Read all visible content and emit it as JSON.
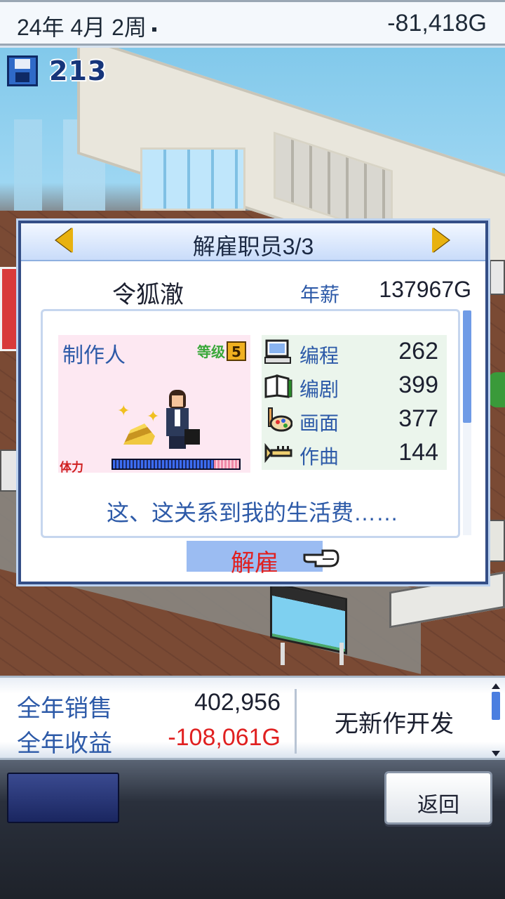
{
  "status_bar": {
    "date": "24年 4月 2周",
    "money": "-81,418G"
  },
  "save": {
    "icon": "floppy-disk-icon",
    "count": "213"
  },
  "dialog": {
    "title": "解雇职员3/3",
    "employee": {
      "name": "令狐澈",
      "salary_label": "年薪",
      "salary_value": "137967G",
      "role": "制作人",
      "level_label": "等级",
      "level_value": "5",
      "stamina_label": "体力",
      "stamina_fraction": 0.8,
      "stats": [
        {
          "icon": "computer-icon",
          "label": "编程",
          "value": "262"
        },
        {
          "icon": "book-icon",
          "label": "编剧",
          "value": "399"
        },
        {
          "icon": "palette-icon",
          "label": "画面",
          "value": "377"
        },
        {
          "icon": "trumpet-icon",
          "label": "作曲",
          "value": "144"
        }
      ],
      "quote": "这、这关系到我的生活费……"
    },
    "fire_button": "解雇"
  },
  "info": {
    "annual_sales_label": "全年销售",
    "annual_sales_value": "402,956",
    "annual_profit_label": "全年收益",
    "annual_profit_value": "-108,061G",
    "dev_status": "无新作开发"
  },
  "bottom": {
    "back_button": "返回"
  },
  "colors": {
    "label_blue": "#2d5aa8",
    "negative_red": "#e02020",
    "dialog_border": "#344e86",
    "stats_bg": "#ebf5ec",
    "portrait_bg": "#fde8f2"
  }
}
